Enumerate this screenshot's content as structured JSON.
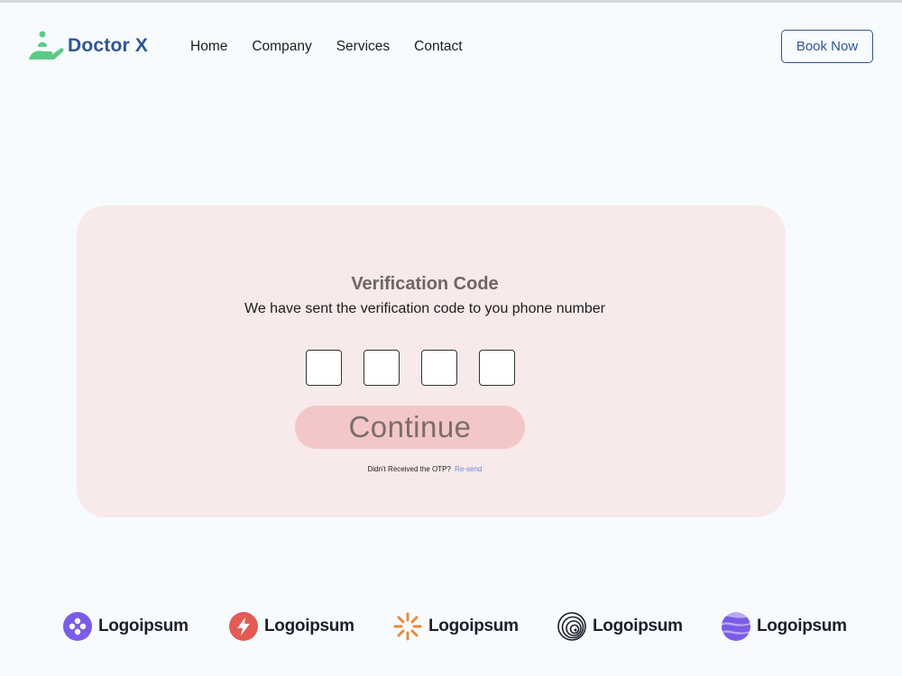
{
  "header": {
    "brand_name": "Doctor X",
    "nav": [
      "Home",
      "Company",
      "Services",
      "Contact"
    ],
    "cta_label": "Book Now",
    "brand_color": "#2f5593",
    "logo_icon_color": "#5cc987"
  },
  "verification": {
    "title": "Verification Code",
    "subtitle": "We have sent the verification code to you phone number",
    "otp_fields": [
      "",
      "",
      "",
      ""
    ],
    "continue_label": "Continue",
    "resend_prompt": "Didn't Received the OTP?",
    "resend_link": "Re-send",
    "card_color": "#f8e9ea",
    "button_color": "#f3c7c7"
  },
  "partner_logos": [
    {
      "icon": "purple-circle-dots-icon",
      "label": "Logoipsum",
      "color": "#7b5ce6"
    },
    {
      "icon": "red-bolt-icon",
      "label": "Logoipsum",
      "color": "#e45a54"
    },
    {
      "icon": "orange-sunburst-icon",
      "label": "Logoipsum",
      "color": "#e88a3a"
    },
    {
      "icon": "black-spiral-icon",
      "label": "Logoipsum",
      "color": "#1e1e2a"
    },
    {
      "icon": "purple-wave-icon",
      "label": "Logoipsum",
      "color": "#7b5ce6"
    }
  ]
}
